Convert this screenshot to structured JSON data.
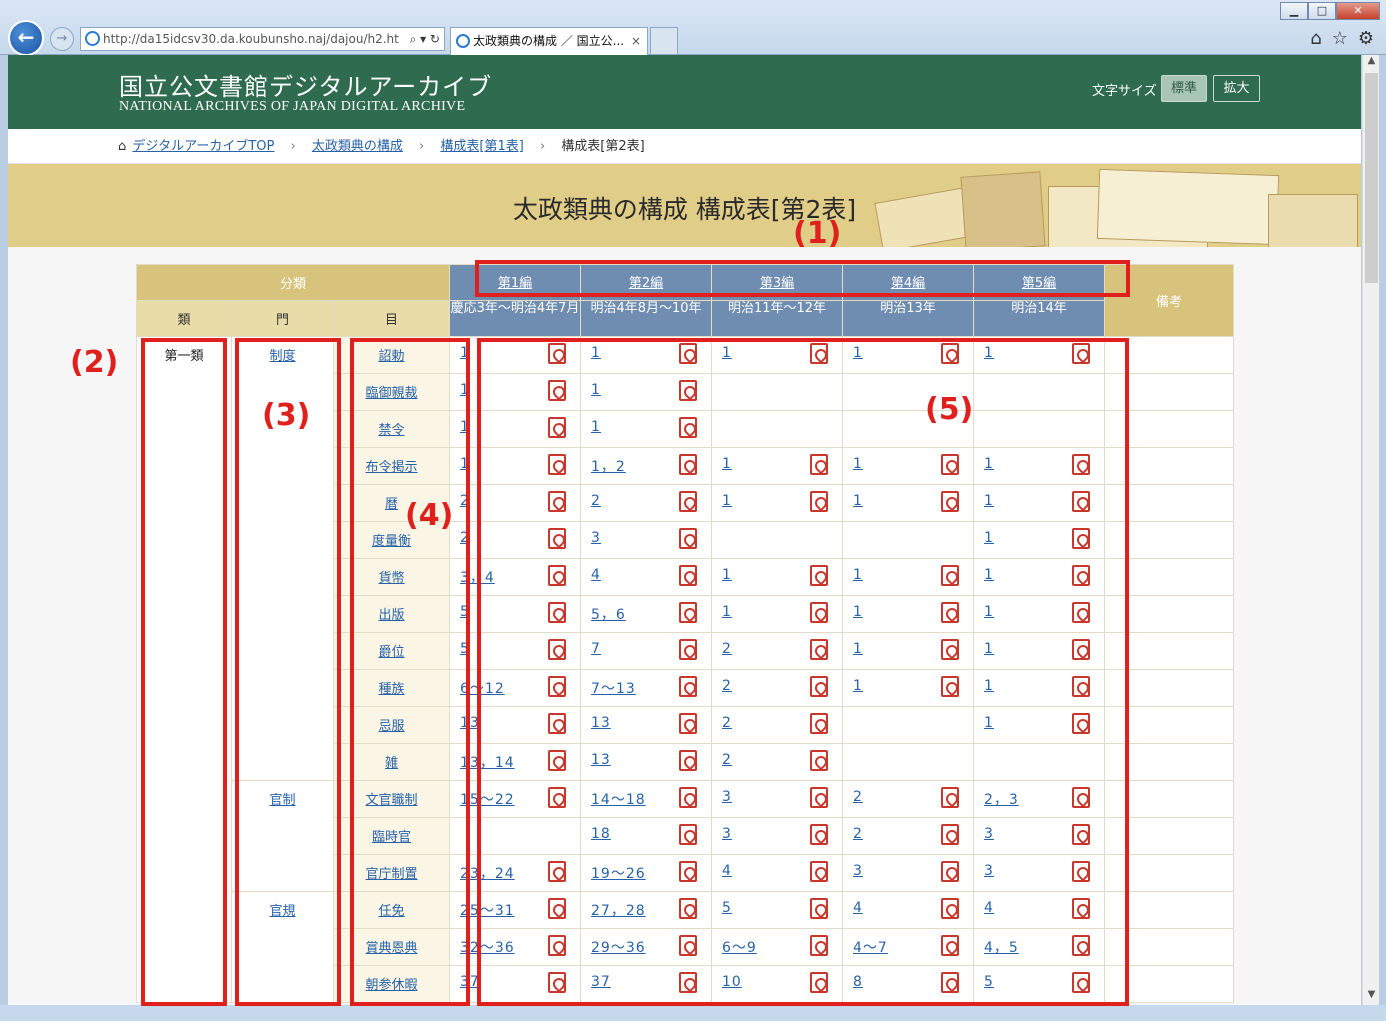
{
  "browser": {
    "address": "http://da15idcsv30.da.koubunsho.naj/dajou/h2.ht",
    "tab_title": "太政類典の構成 ／ 国立公...",
    "tab_close": "×"
  },
  "header": {
    "logo_jp": "国立公文書館デジタルアーカイブ",
    "logo_en": "NATIONAL ARCHIVES OF JAPAN  DIGITAL ARCHIVE",
    "font_size_label": "文字サイズ",
    "font_standard": "標準",
    "font_large": "拡大"
  },
  "breadcrumb": {
    "items": [
      "デジタルアーカイブTOP",
      "太政類典の構成",
      "構成表[第1表]"
    ],
    "current": "構成表[第2表]"
  },
  "banner": {
    "title": "太政類典の構成 構成表[第2表]"
  },
  "table": {
    "classification": "分類",
    "col_rui": "類",
    "col_mon": "門",
    "col_moku": "目",
    "note": "備考",
    "editions": [
      {
        "label": "第1編",
        "period": "慶応3年～明治4年7月"
      },
      {
        "label": "第2編",
        "period": "明治4年8月～10年"
      },
      {
        "label": "第3編",
        "period": "明治11年～12年"
      },
      {
        "label": "第4編",
        "period": "明治13年"
      },
      {
        "label": "第5編",
        "period": "明治14年"
      }
    ],
    "rui_1": "第一類",
    "mon": [
      "制度",
      "官制",
      "官規"
    ],
    "rows": [
      {
        "moku": "詔勅",
        "c": [
          "1",
          "1",
          "1",
          "1",
          "1"
        ]
      },
      {
        "moku": "臨御親裁",
        "c": [
          "1",
          "1",
          "",
          "",
          ""
        ]
      },
      {
        "moku": "禁令",
        "c": [
          "1",
          "1",
          "",
          "",
          ""
        ]
      },
      {
        "moku": "布令掲示",
        "c": [
          "1",
          "1，2",
          "1",
          "1",
          "1"
        ]
      },
      {
        "moku": "暦",
        "c": [
          "2",
          "2",
          "1",
          "1",
          "1"
        ]
      },
      {
        "moku": "度量衡",
        "c": [
          "2",
          "3",
          "",
          "",
          "1"
        ]
      },
      {
        "moku": "貨幣",
        "c": [
          "3，4",
          "4",
          "1",
          "1",
          "1"
        ]
      },
      {
        "moku": "出版",
        "c": [
          "5",
          "5，6",
          "1",
          "1",
          "1"
        ]
      },
      {
        "moku": "爵位",
        "c": [
          "5",
          "7",
          "2",
          "1",
          "1"
        ]
      },
      {
        "moku": "種族",
        "c": [
          "6～12",
          "7～13",
          "2",
          "1",
          "1"
        ]
      },
      {
        "moku": "忌服",
        "c": [
          "13",
          "13",
          "2",
          "",
          "1"
        ]
      },
      {
        "moku": "雑",
        "c": [
          "13，14",
          "13",
          "2",
          "",
          ""
        ]
      },
      {
        "moku": "文官職制",
        "c": [
          "15～22",
          "14～18",
          "3",
          "2",
          "2，3"
        ]
      },
      {
        "moku": "臨時官",
        "c": [
          "",
          "18",
          "3",
          "2",
          "3"
        ]
      },
      {
        "moku": "官庁制置",
        "c": [
          "23，24",
          "19～26",
          "4",
          "3",
          "3"
        ]
      },
      {
        "moku": "任免",
        "c": [
          "25～31",
          "27，28",
          "5",
          "4",
          "4"
        ]
      },
      {
        "moku": "賞典恩典",
        "c": [
          "32～36",
          "29～36",
          "6～9",
          "4～7",
          "4，5"
        ]
      },
      {
        "moku": "朝参休暇",
        "c": [
          "37",
          "37",
          "10",
          "8",
          "5"
        ]
      }
    ]
  },
  "annotations": [
    "(1)",
    "(2)",
    "(3)",
    "(4)",
    "(5)"
  ],
  "colors": {
    "header_green": "#2f6b4e",
    "accent_red": "#e0201c",
    "edition_blue": "#6f8db0",
    "gold": "#d7c37b"
  }
}
